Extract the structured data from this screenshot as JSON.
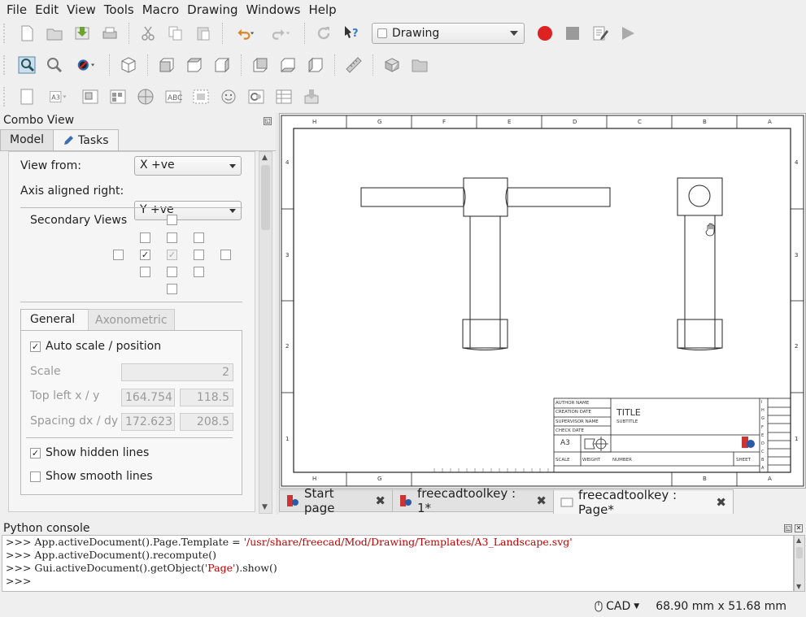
{
  "menu": [
    "File",
    "Edit",
    "View",
    "Tools",
    "Macro",
    "Drawing",
    "Windows",
    "Help"
  ],
  "workbench": "Drawing",
  "combo": {
    "title": "Combo View",
    "tabs": [
      "Model",
      "Tasks"
    ]
  },
  "task": {
    "view_from_label": "View from:",
    "view_from_value": "X +ve",
    "axis_label": "Axis aligned right:",
    "axis_value": "Y +ve",
    "secondary_label": "Secondary Views",
    "tabs": [
      "General",
      "Axonometric"
    ],
    "auto_scale": "Auto scale / position",
    "scale_label": "Scale",
    "scale_value": "2",
    "topleft_label": "Top left x / y",
    "topleft_x": "164.754",
    "topleft_y": "118.5",
    "spacing_label": "Spacing dx / dy",
    "spacing_dx": "172.623",
    "spacing_dy": "208.5",
    "show_hidden": "Show hidden lines",
    "show_smooth": "Show smooth lines"
  },
  "sheet": {
    "cols_top": [
      "H",
      "G",
      "F",
      "E",
      "D",
      "C",
      "B",
      "A"
    ],
    "cols_bottom": [
      "H",
      "G",
      "B",
      "A"
    ],
    "rows_left": [
      "4",
      "3",
      "2",
      "1"
    ],
    "rows_right": [
      "4",
      "3",
      "2",
      "1"
    ],
    "title_block": {
      "author": "AUTHOR NAME",
      "creation": "CREATION DATE",
      "supervisor": "SUPERVISOR NAME",
      "check": "CHECK DATE",
      "size": "A3",
      "title": "TITLE",
      "subtitle": "SUBTITLE",
      "scale": "SCALE",
      "weight": "WEIGHT",
      "number": "NUMBER",
      "sheet": "SHEET",
      "rev_letters": [
        "I",
        "H",
        "G",
        "F",
        "E",
        "D",
        "C",
        "B",
        "A"
      ]
    }
  },
  "doc_tabs": [
    {
      "label": "Start page"
    },
    {
      "label": "freecadtoolkey : 1*"
    },
    {
      "label": "freecadtoolkey : Page*"
    }
  ],
  "python": {
    "title": "Python console",
    "prompt": ">>>",
    "line1_code": "App.activeDocument().Page.Template = ",
    "line1_str": "'/usr/share/freecad/Mod/Drawing/Templates/A3_Landscape.svg'",
    "line2": "App.activeDocument().recompute()",
    "line3_a": "Gui.activeDocument().getObject(",
    "line3_str": "'Page'",
    "line3_b": ").show()"
  },
  "status": {
    "nav": "CAD",
    "dims": "68.90 mm x 51.68 mm"
  }
}
